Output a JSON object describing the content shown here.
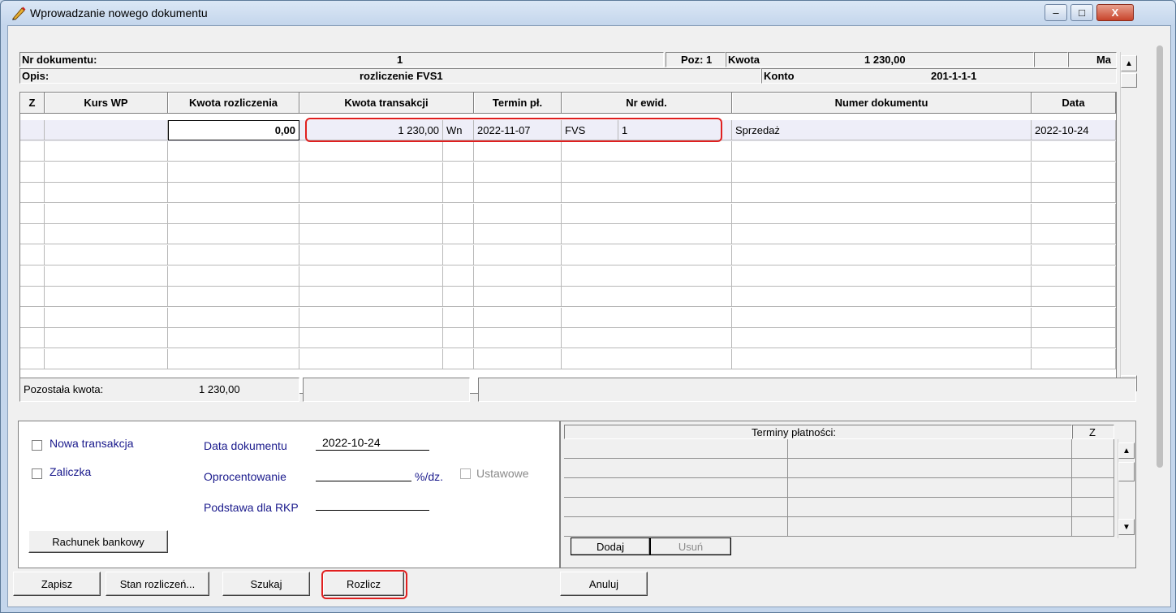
{
  "window": {
    "title": "Wprowadzanie nowego dokumentu",
    "minimize": "–",
    "maximize": "□",
    "close": "X"
  },
  "header": {
    "nr_dok_label": "Nr dokumentu:",
    "nr_dok_value": "1",
    "poz_label": "Poz: 1",
    "kwota_label": "Kwota",
    "kwota_value": "1 230,00",
    "ma_label": "Ma",
    "opis_label": "Opis:",
    "opis_value": "rozliczenie FVS1",
    "konto_label": "Konto",
    "konto_value": "201-1-1-1"
  },
  "table": {
    "columns": [
      "Z",
      "Kurs WP",
      "Kwota rozliczenia",
      "Kwota transakcji",
      "Termin pł.",
      "Nr ewid.",
      "Numer dokumentu",
      "Data"
    ],
    "row": {
      "z": "",
      "kurs_wp": "",
      "kwota_rozliczenia": "0,00",
      "kwota_transakcji": "1 230,00",
      "strona": "Wn",
      "termin": "2022-11-07",
      "nr_ewid_prefix": "FVS",
      "nr_ewid_num": "1",
      "numer_dokumentu": "Sprzedaż",
      "data": "2022-10-24"
    }
  },
  "status": {
    "pozostala_label": "Pozostała kwota:",
    "pozostala_value": "1 230,00"
  },
  "options": {
    "nowa_transakcja": "Nowa transakcja",
    "zaliczka": "Zaliczka",
    "data_dok_label": "Data dokumentu",
    "data_dok_value": "2022-10-24",
    "oprocentowanie_label": "Oprocentowanie",
    "procent_unit": "%/dz.",
    "ustawowe": "Ustawowe",
    "podstawa_label": "Podstawa dla RKP",
    "rachunek_button": "Rachunek bankowy"
  },
  "terminy": {
    "title": "Terminy płatności:",
    "z_col": "Z",
    "dodaj": "Dodaj",
    "usun": "Usuń"
  },
  "footer": {
    "zapisz": "Zapisz",
    "stan": "Stan rozliczeń...",
    "szukaj": "Szukaj",
    "rozlicz": "Rozlicz",
    "anuluj": "Anuluj"
  }
}
